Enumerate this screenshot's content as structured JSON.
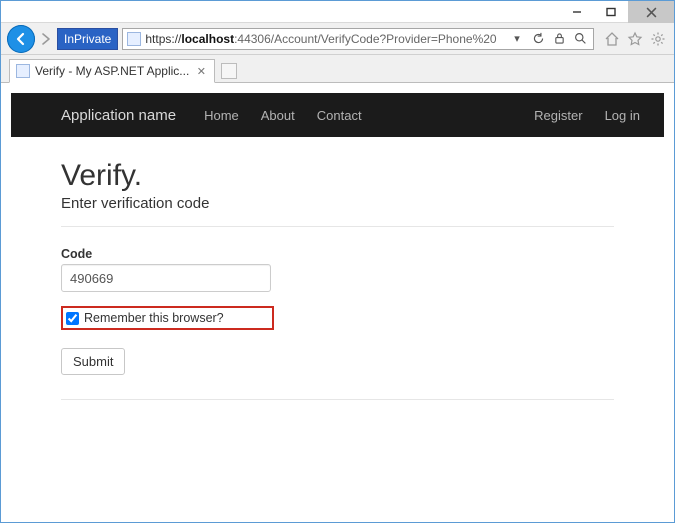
{
  "browser": {
    "inprivate_label": "InPrivate",
    "url_scheme": "https://",
    "url_host": "localhost",
    "url_rest": ":44306/Account/VerifyCode?Provider=Phone%20",
    "tab_title": "Verify - My ASP.NET Applic...",
    "window_controls": {
      "minimize": "minimize",
      "maximize": "maximize",
      "close": "close"
    }
  },
  "navbar": {
    "brand": "Application name",
    "links": {
      "home": "Home",
      "about": "About",
      "contact": "Contact"
    },
    "right": {
      "register": "Register",
      "login": "Log in"
    }
  },
  "page": {
    "title": "Verify.",
    "subtitle": "Enter verification code",
    "code_label": "Code",
    "code_value": "490669",
    "remember_label": "Remember this browser?",
    "remember_checked": true,
    "submit_label": "Submit"
  }
}
